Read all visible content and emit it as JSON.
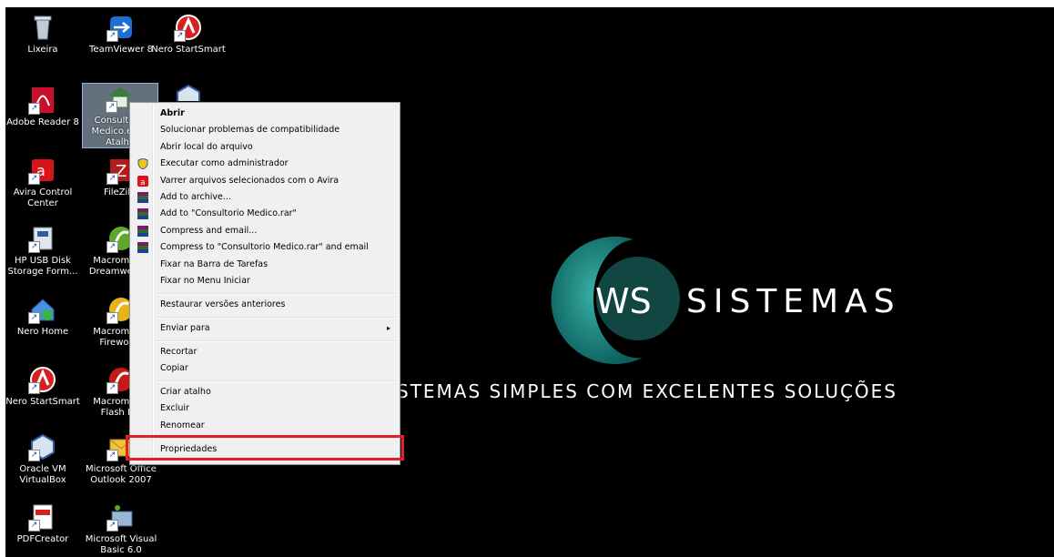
{
  "desktop_icons": [
    {
      "label": "Lixeira"
    },
    {
      "label": "TeamViewer 8"
    },
    {
      "label": "Nero StartSmart"
    },
    {
      "label": "Adobe Reader 8"
    },
    {
      "label": "Consultorio Medico.exe - Atalho"
    },
    {
      "label": "Avira Control Center"
    },
    {
      "label": "FileZilla"
    },
    {
      "label": "HP USB Disk Storage Form..."
    },
    {
      "label": "Macromedia Dreamweaver"
    },
    {
      "label": "Nero Home"
    },
    {
      "label": "Macromedia Fireworks"
    },
    {
      "label": "Nero StartSmart"
    },
    {
      "label": "Macromedia Flash MX"
    },
    {
      "label": "Oracle VM VirtualBox"
    },
    {
      "label": "Microsoft Office Outlook 2007"
    },
    {
      "label": "PDFCreator"
    },
    {
      "label": "Microsoft Visual Basic 6.0"
    }
  ],
  "logo": {
    "title": "SISTEMAS",
    "monogram": "WS",
    "slogan": "STEMAS SIMPLES COM EXCELENTES SOLUÇÕES",
    "accent_color": "#1f8f88"
  },
  "context_menu": {
    "items": [
      {
        "label": "Abrir",
        "bold": true
      },
      {
        "label": "Solucionar problemas de compatibilidade"
      },
      {
        "label": "Abrir local do arquivo"
      },
      {
        "label": "Executar como administrador",
        "icon": "uac-shield-icon"
      },
      {
        "label": "Varrer arquivos selecionados com o Avira",
        "icon": "avira-icon"
      },
      {
        "label": "Add to archive...",
        "icon": "winrar-icon"
      },
      {
        "label": "Add to \"Consultorio Medico.rar\"",
        "icon": "winrar-icon"
      },
      {
        "label": "Compress and email...",
        "icon": "winrar-icon"
      },
      {
        "label": "Compress to \"Consultorio Medico.rar\" and email",
        "icon": "winrar-icon"
      },
      {
        "label": "Fixar na Barra de Tarefas"
      },
      {
        "label": "Fixar no Menu Iniciar"
      },
      {
        "label": "Restaurar versões anteriores"
      },
      {
        "label": "Enviar para",
        "submenu": true
      },
      {
        "label": "Recortar"
      },
      {
        "label": "Copiar"
      },
      {
        "label": "Criar atalho"
      },
      {
        "label": "Excluir"
      },
      {
        "label": "Renomear"
      },
      {
        "label": "Propriedades",
        "highlighted": true
      }
    ],
    "submenu_arrow": "▸"
  },
  "highlight_color": "#e21f26"
}
